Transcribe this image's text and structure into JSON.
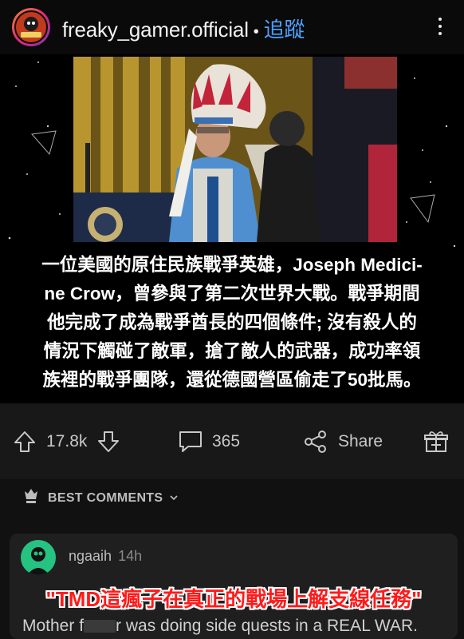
{
  "header": {
    "username": "freaky_gamer.official",
    "separator": "•",
    "follow_label": "追蹤",
    "avatar_text": "Freaky Gamer"
  },
  "post": {
    "caption_lines": [
      "一位美國的原住民族戰爭英雄，Joseph Medici-",
      "ne Crow，曾參與了第二次世界大戰。戰爭期間",
      "他完成了成為戰爭酋長的四個條件; 沒有殺人的",
      "情況下觸碰了敵軍，搶了敵人的武器，成功率領",
      "族裡的戰爭團隊，還從德國營區偷走了50批馬。"
    ]
  },
  "actions": {
    "upvotes": "17.8k",
    "comments": "365",
    "share_label": "Share"
  },
  "comments_section": {
    "heading": "BEST COMMENTS",
    "comment": {
      "username": "ngaaih",
      "time": "14h",
      "overlay_text": "\"TMD這瘋子在真正的戰場上解支線任務\"",
      "body_prefix": "Mother f",
      "body_suffix": "r was doing side quests in a REAL WAR."
    }
  },
  "colors": {
    "background": "#111111",
    "follow": "#4da3ff",
    "comment_avatar": "#26c281",
    "overlay_text": "#ff1a1a"
  }
}
